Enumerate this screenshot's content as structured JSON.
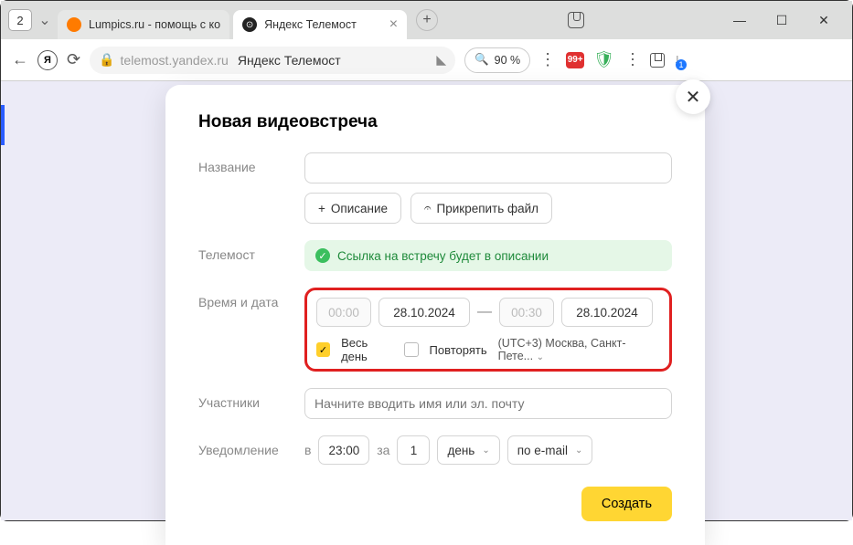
{
  "window": {
    "tab_count": "2",
    "tabs": [
      {
        "title": "Lumpics.ru - помощь с ко"
      },
      {
        "title": "Яндекс Телемост"
      }
    ],
    "zoom": "90 %",
    "ext_badge": "99+",
    "download_badge": "1"
  },
  "address": {
    "domain": "telemost.yandex.ru",
    "page_title": "Яндекс Телемост"
  },
  "modal": {
    "title": "Новая видеовстреча",
    "labels": {
      "name": "Название",
      "telemost": "Телемост",
      "datetime": "Время и дата",
      "participants": "Участники",
      "notification": "Уведомление"
    },
    "buttons": {
      "description": "Описание",
      "attach": "Прикрепить файл",
      "create": "Создать"
    },
    "banner": "Ссылка на встречу будет в описании",
    "datetime": {
      "time_from": "00:00",
      "date_from": "28.10.2024",
      "time_to": "00:30",
      "date_to": "28.10.2024",
      "all_day": "Весь день",
      "repeat": "Повторять",
      "timezone": "(UTC+3) Москва, Санкт-Пете..."
    },
    "participants_placeholder": "Начните вводить имя или эл. почту",
    "notification": {
      "at": "в",
      "time": "23:00",
      "before": "за",
      "qty": "1",
      "unit": "день",
      "method": "по e-mail"
    }
  }
}
